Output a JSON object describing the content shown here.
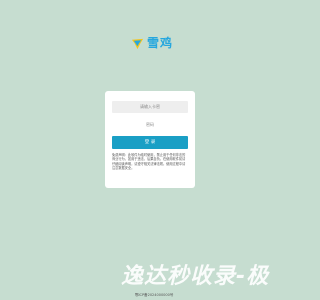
{
  "brand": {
    "name": "雪鸡"
  },
  "login": {
    "code_placeholder": "请输入卡密",
    "password_placeholder": "密码",
    "submit_label": "登 录",
    "notice": "免费声明：此软件为临时使用，禁止用于任何非法的商业行为，如用于违法，后果自负。在使用软件前请仔细阅读声明，请遵守相关法律法规。使用过程中请注意数据安全。"
  },
  "footer": {
    "icp": "鄂ICP备2024000000号"
  },
  "watermark": {
    "text": "逸达秒收录-极"
  },
  "colors": {
    "background": "#c6ddd0",
    "accent": "#1a9fc5",
    "brand": "#26a7de"
  }
}
